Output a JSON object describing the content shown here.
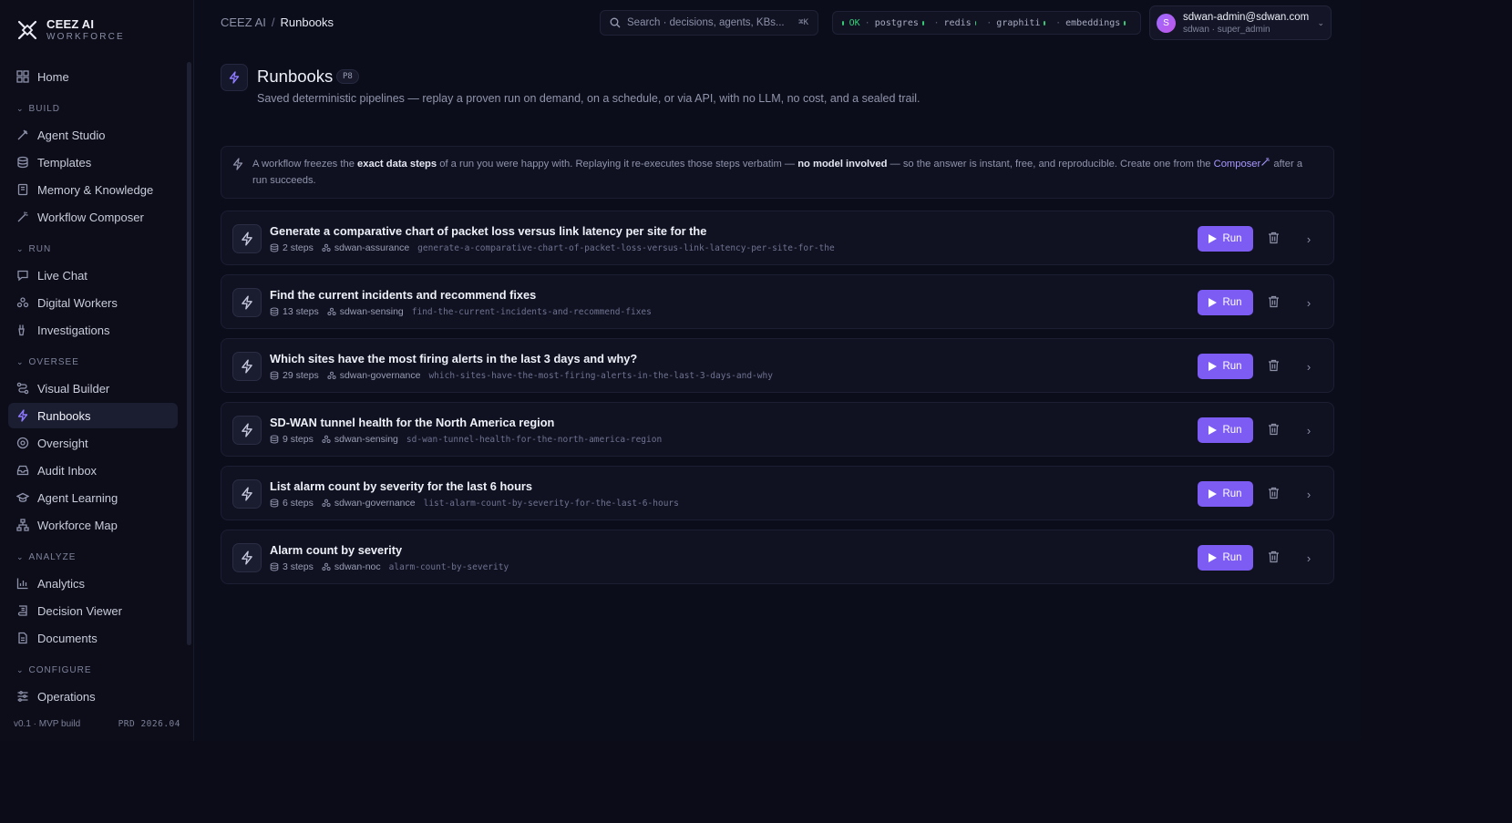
{
  "brand": {
    "name": "CEEZ AI",
    "subtitle": "WORKFORCE"
  },
  "sidebar": {
    "home": "Home",
    "sections": [
      {
        "title": "BUILD",
        "items": [
          {
            "label": "Agent Studio",
            "icon": "wand-icon"
          },
          {
            "label": "Templates",
            "icon": "stack-icon"
          },
          {
            "label": "Memory & Knowledge",
            "icon": "book-icon"
          },
          {
            "label": "Workflow Composer",
            "icon": "magic-icon"
          }
        ]
      },
      {
        "title": "RUN",
        "items": [
          {
            "label": "Live Chat",
            "icon": "chat-icon"
          },
          {
            "label": "Digital Workers",
            "icon": "workers-icon"
          },
          {
            "label": "Investigations",
            "icon": "investigate-icon"
          }
        ]
      },
      {
        "title": "OVERSEE",
        "items": [
          {
            "label": "Visual Builder",
            "icon": "route-icon"
          },
          {
            "label": "Runbooks",
            "icon": "bolt-icon",
            "active": true
          },
          {
            "label": "Oversight",
            "icon": "eye-icon"
          },
          {
            "label": "Audit Inbox",
            "icon": "inbox-icon"
          },
          {
            "label": "Agent Learning",
            "icon": "graduation-icon"
          },
          {
            "label": "Workforce Map",
            "icon": "network-icon"
          }
        ]
      },
      {
        "title": "ANALYZE",
        "items": [
          {
            "label": "Analytics",
            "icon": "bar-chart-icon"
          },
          {
            "label": "Decision Viewer",
            "icon": "scroll-icon"
          },
          {
            "label": "Documents",
            "icon": "document-icon"
          }
        ]
      },
      {
        "title": "CONFIGURE",
        "items": [
          {
            "label": "Operations",
            "icon": "sliders-icon"
          }
        ]
      }
    ],
    "footer_left": "v0.1 · MVP build",
    "footer_right": "PRD 2026.04"
  },
  "header": {
    "breadcrumb_root": "CEEZ AI",
    "breadcrumb_sep": "/",
    "breadcrumb_current": "Runbooks",
    "search_placeholder": "Search · decisions, agents, KBs...",
    "search_shortcut": "⌘K",
    "status": {
      "ok": "OK",
      "services": [
        "postgres",
        "redis",
        "graphiti",
        "embeddings"
      ]
    },
    "user": {
      "initial": "S",
      "email": "sdwan-admin@sdwan.com",
      "role": "sdwan · super_admin"
    }
  },
  "page": {
    "title": "Runbooks",
    "badge": "P8",
    "description": "Saved deterministic pipelines — replay a proven run on demand, on a schedule, or via API, with no LLM, no cost, and a sealed trail."
  },
  "info": {
    "t1": "A workflow freezes the ",
    "b1": "exact data steps",
    "t2": " of a run you were happy with. Replaying it re-executes those steps verbatim — ",
    "b2": "no model involved",
    "t3": " — so the answer is instant, free, and reproducible. Create one from the ",
    "link": "Composer",
    "t4": " after a run succeeds."
  },
  "run_label": "Run",
  "runbooks": [
    {
      "title": "Generate a comparative chart of packet loss versus link latency per site for the",
      "steps": "2 steps",
      "agent": "sdwan-assurance",
      "slug": "generate-a-comparative-chart-of-packet-loss-versus-link-latency-per-site-for-the"
    },
    {
      "title": "Find the current incidents and recommend fixes",
      "steps": "13 steps",
      "agent": "sdwan-sensing",
      "slug": "find-the-current-incidents-and-recommend-fixes"
    },
    {
      "title": "Which sites have the most firing alerts in the last 3 days and why?",
      "steps": "29 steps",
      "agent": "sdwan-governance",
      "slug": "which-sites-have-the-most-firing-alerts-in-the-last-3-days-and-why"
    },
    {
      "title": "SD-WAN tunnel health for the North America region",
      "steps": "9 steps",
      "agent": "sdwan-sensing",
      "slug": "sd-wan-tunnel-health-for-the-north-america-region"
    },
    {
      "title": "List alarm count by severity for the last 6 hours",
      "steps": "6 steps",
      "agent": "sdwan-governance",
      "slug": "list-alarm-count-by-severity-for-the-last-6-hours"
    },
    {
      "title": "Alarm count by severity",
      "steps": "3 steps",
      "agent": "sdwan-noc",
      "slug": "alarm-count-by-severity"
    }
  ]
}
